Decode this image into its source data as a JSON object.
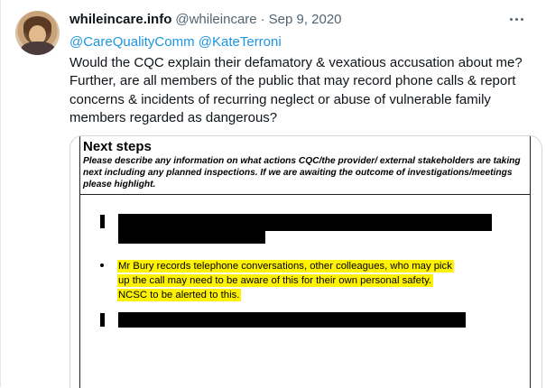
{
  "tweet": {
    "display_name": "whileincare.info",
    "handle": "@whileincare",
    "separator": "·",
    "date": "Sep 9, 2020",
    "mention_1": "@CareQualityComm",
    "mention_2": "@KateTerroni",
    "text": "Would the CQC explain their defamatory & vexatious accusation about me? Further, are all members of the public that may record phone calls & report concerns & incidents of recurring neglect or abuse of vulnerable family members regarded as dangerous?"
  },
  "document": {
    "title": "Next steps",
    "instructions": "Please describe any information on what actions CQC/the provider/ external stakeholders are taking next including any planned inspections. If we are awaiting the outcome of investigations/meetings please highlight.",
    "bullet_marker": "•",
    "highlighted_lines": [
      "Mr Bury records telephone conversations, other colleagues, who may pick",
      "up the call may need to be aware of this for their own personal safety.",
      "NCSC to be alerted to this."
    ]
  },
  "colors": {
    "link": "#1b95e0",
    "highlight": "#fff200",
    "secondary_text": "#536471"
  },
  "icons": {
    "more": "more-horizontal-icon"
  }
}
